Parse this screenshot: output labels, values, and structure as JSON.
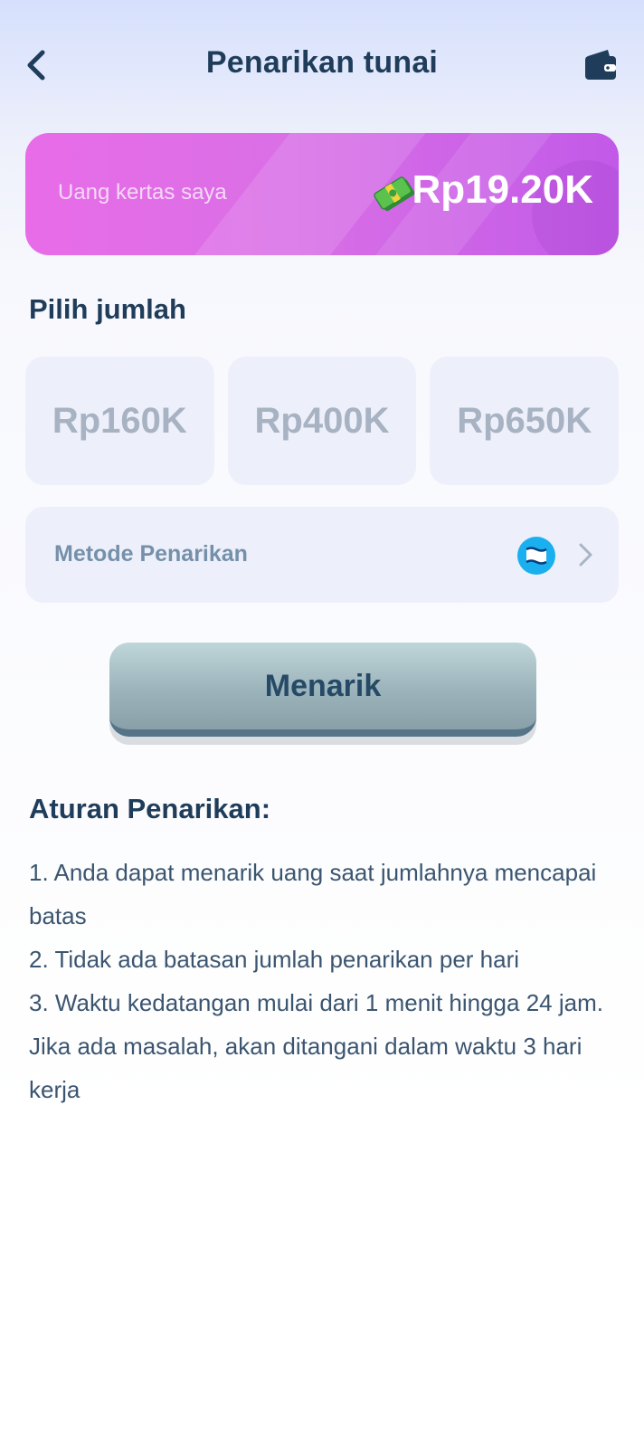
{
  "header": {
    "title": "Penarikan tunai",
    "back_icon": "chevron-left-icon",
    "wallet_icon": "wallet-icon"
  },
  "balance": {
    "label": "Uang kertas saya",
    "value": "Rp19.20K",
    "icon": "money-stack-icon"
  },
  "amount_section": {
    "title": "Pilih jumlah",
    "options": [
      "Rp160K",
      "Rp400K",
      "Rp650K"
    ]
  },
  "method": {
    "label": "Metode Penarikan",
    "icon": "payment-method-icon"
  },
  "withdraw_button": {
    "label": "Menarik"
  },
  "rules": {
    "title": "Aturan Penarikan:",
    "items": [
      "1. Anda dapat menarik uang saat jumlahnya mencapai batas",
      "2. Tidak ada batasan jumlah penarikan per hari",
      "3. Waktu kedatangan mulai dari 1 menit hingga 24 jam. Jika ada masalah, akan ditangani dalam waktu 3 hari kerja"
    ]
  },
  "colors": {
    "title_text": "#1f3d5a",
    "card_pink": "#e86ce8",
    "card_purple": "#c25ae8",
    "tile_bg": "#edf0fa",
    "tile_text": "#a7b2c2",
    "method_icon": "#1ab0f0",
    "button_bottom": "#557488"
  }
}
